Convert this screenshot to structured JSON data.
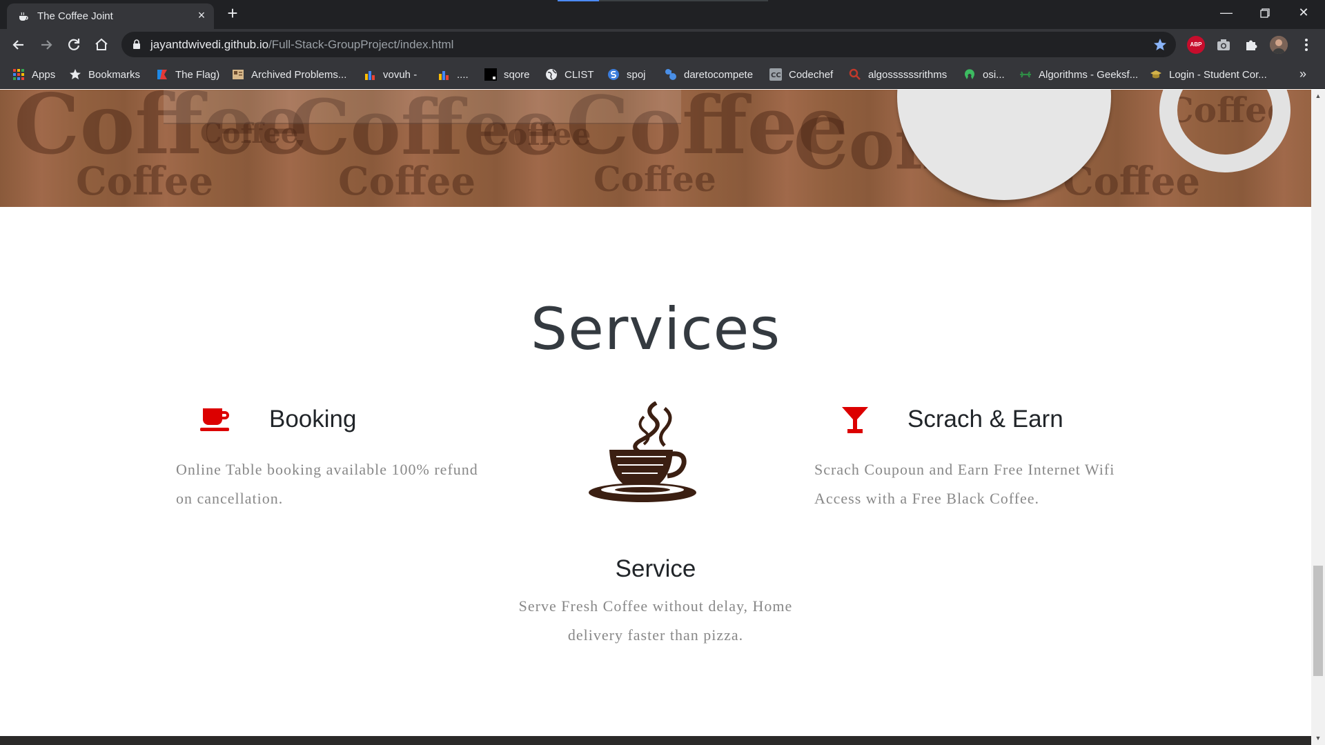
{
  "browser": {
    "tab_title": "The Coffee Joint",
    "url_host": "jayantdwivedi.github.io",
    "url_path": "/Full-Stack-GroupProject/index.html",
    "abp_label": "ABP",
    "bookmarks": [
      {
        "label": "Apps",
        "icon": "apps-grid-icon",
        "color": "#ea4335"
      },
      {
        "label": "Bookmarks",
        "icon": "star-icon",
        "color": "#e8eaed"
      },
      {
        "label": "The Flag)",
        "icon": "flag-icon",
        "color": "#e53935"
      },
      {
        "label": "Archived Problems...",
        "icon": "archive-icon",
        "color": "#d7b88a"
      },
      {
        "label": "vovuh -",
        "icon": "bar-chart-icon",
        "color": "#fbbc04"
      },
      {
        "label": "....",
        "icon": "bar-chart-icon",
        "color": "#fbbc04"
      },
      {
        "label": "sqore",
        "icon": "square-icon",
        "color": "#000000"
      },
      {
        "label": "CLIST",
        "icon": "globe-icon",
        "color": "#e8eaed"
      },
      {
        "label": "spoj",
        "icon": "spoj-icon",
        "color": "#3b7ddd"
      },
      {
        "label": "daretocompete",
        "icon": "dtc-icon",
        "color": "#4a8fe7"
      },
      {
        "label": "Codechef",
        "icon": "codechef-icon",
        "color": "#9aa0a6"
      },
      {
        "label": "algossssssrithms",
        "icon": "search-icon",
        "color": "#c0392b"
      },
      {
        "label": "osi...",
        "icon": "osi-icon",
        "color": "#3dbb61"
      },
      {
        "label": "Algorithms - Geeksf...",
        "icon": "gfg-icon",
        "color": "#2f8d46"
      },
      {
        "label": "Login - Student Cor...",
        "icon": "hat-icon",
        "color": "#d4b34a"
      }
    ]
  },
  "page": {
    "hero_word": "Coffee",
    "services_title": "Services",
    "services": [
      {
        "title": "Booking",
        "icon": "coffee-mug-icon",
        "description": [
          "Online Table booking available 100% refund",
          "on cancellation."
        ]
      },
      {
        "title": "Scrach & Earn",
        "icon": "cocktail-glass-icon",
        "description": [
          "Scrach Coupoun and Earn Free Internet Wifi",
          "Access with a Free Black Coffee."
        ]
      },
      {
        "title": "Service",
        "icon": "steaming-coffee-cup-icon",
        "description": [
          "Serve Fresh Coffee without delay, Home",
          "delivery faster than pizza."
        ]
      }
    ],
    "accent_color": "#dc0000",
    "cup_color": "#3b1f12"
  }
}
